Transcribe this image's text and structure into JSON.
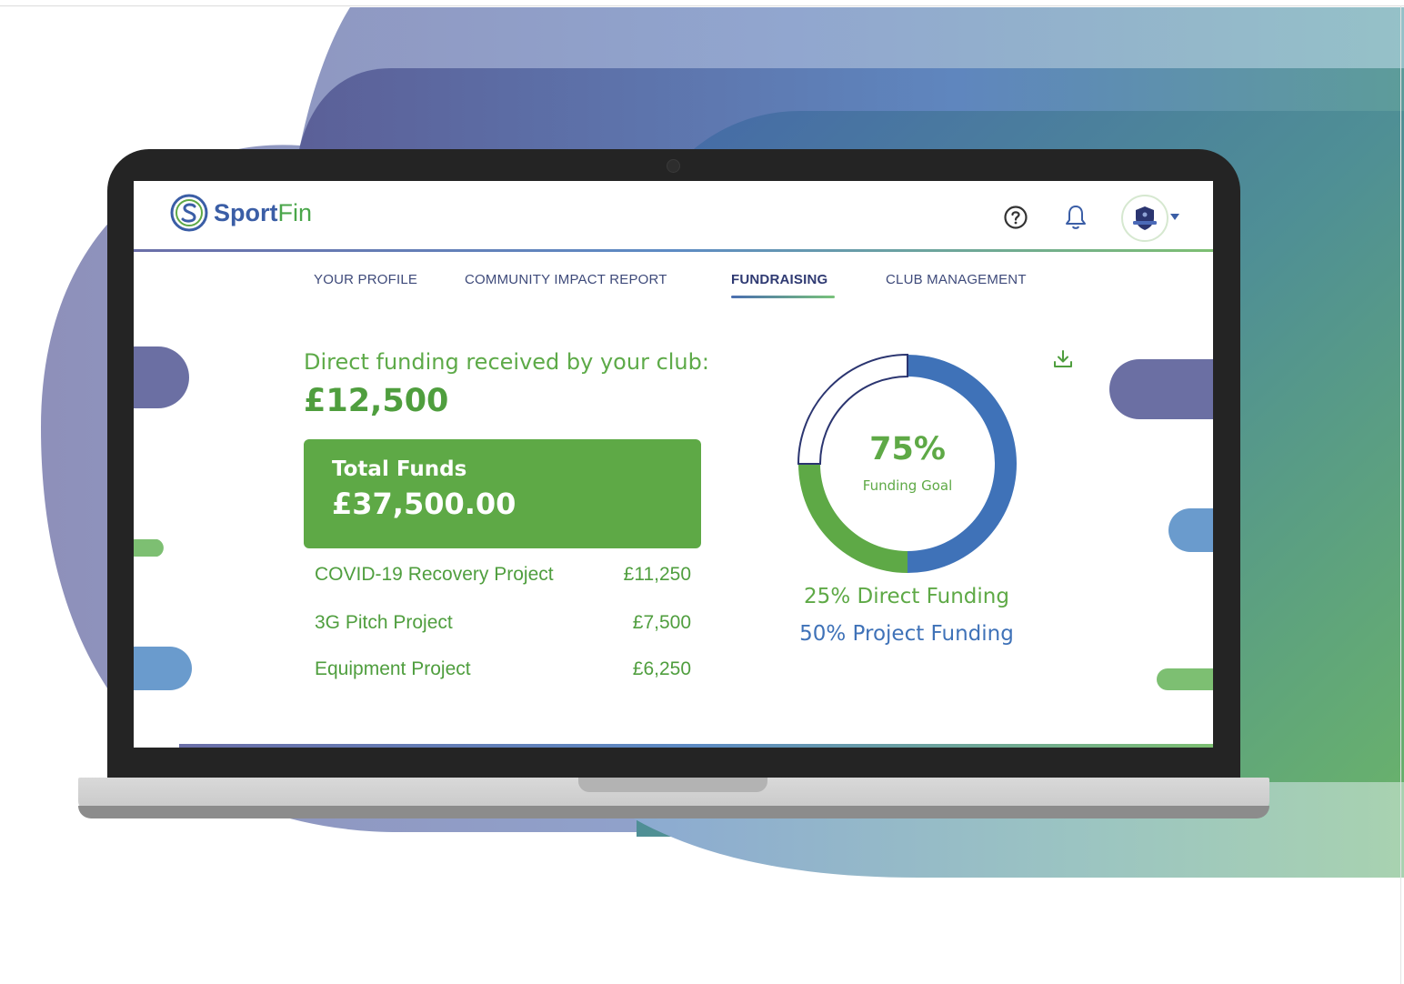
{
  "app": {
    "logo_sport": "Sport",
    "logo_fin": "Fin"
  },
  "header_icons": [
    "help-icon",
    "bell-icon",
    "club-crest-avatar",
    "chevron-down-icon"
  ],
  "nav": {
    "tabs": [
      {
        "label": "YOUR PROFILE"
      },
      {
        "label": "COMMUNITY IMPACT REPORT"
      },
      {
        "label": "FUNDRAISING",
        "active": true
      },
      {
        "label": "CLUB MANAGEMENT"
      }
    ]
  },
  "funding": {
    "direct_label": "Direct funding received by your club:",
    "direct_amount": "£12,500",
    "total_label": "Total Funds",
    "total_amount": "£37,500.00",
    "projects": [
      {
        "name": "COVID-19 Recovery Project",
        "amount": "£11,250"
      },
      {
        "name": "3G Pitch Project",
        "amount": "£7,500"
      },
      {
        "name": "Equipment Project",
        "amount": "£6,250"
      }
    ]
  },
  "goal": {
    "percent_text": "75%",
    "label": "Funding Goal",
    "direct_legend": "25% Direct Funding",
    "project_legend": "50% Project Funding",
    "direct_share": 0.25,
    "project_share": 0.5
  },
  "colors": {
    "brand_green": "#5ea946",
    "brand_blue": "#3f72b8",
    "brand_navy": "#3b5ea6"
  }
}
